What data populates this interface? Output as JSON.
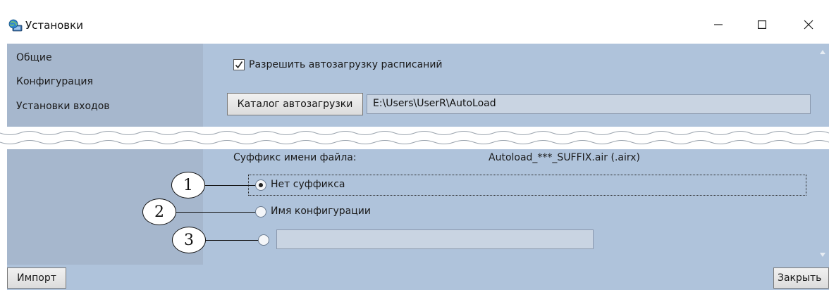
{
  "window": {
    "title": "Установки",
    "icon": "globe-monitor-icon"
  },
  "sidebar": {
    "items": [
      {
        "label": "Общие"
      },
      {
        "label": "Конфигурация"
      },
      {
        "label": "Установки входов"
      }
    ]
  },
  "autoload": {
    "checkbox_label": "Разрешить автозагрузку расписаний",
    "checkbox_checked": true,
    "catalog_button": "Каталог автозагрузки",
    "catalog_path": "E:\\Users\\UserR\\AutoLoad"
  },
  "suffix": {
    "label": "Суффикс имени файла:",
    "value": "Autoload_***_SUFFIX.air (.airx)",
    "options": [
      {
        "label": "Нет суффикса",
        "selected": true
      },
      {
        "label": "Имя конфигурации",
        "selected": false
      },
      {
        "label": "",
        "selected": false,
        "custom_value": ""
      }
    ]
  },
  "callouts": [
    "1",
    "2",
    "3"
  ],
  "footer": {
    "import_button": "Импорт",
    "close_button": "Закрыть"
  },
  "colors": {
    "panel_background": "#afc3db",
    "sidebar_background": "#a6b7cd"
  }
}
